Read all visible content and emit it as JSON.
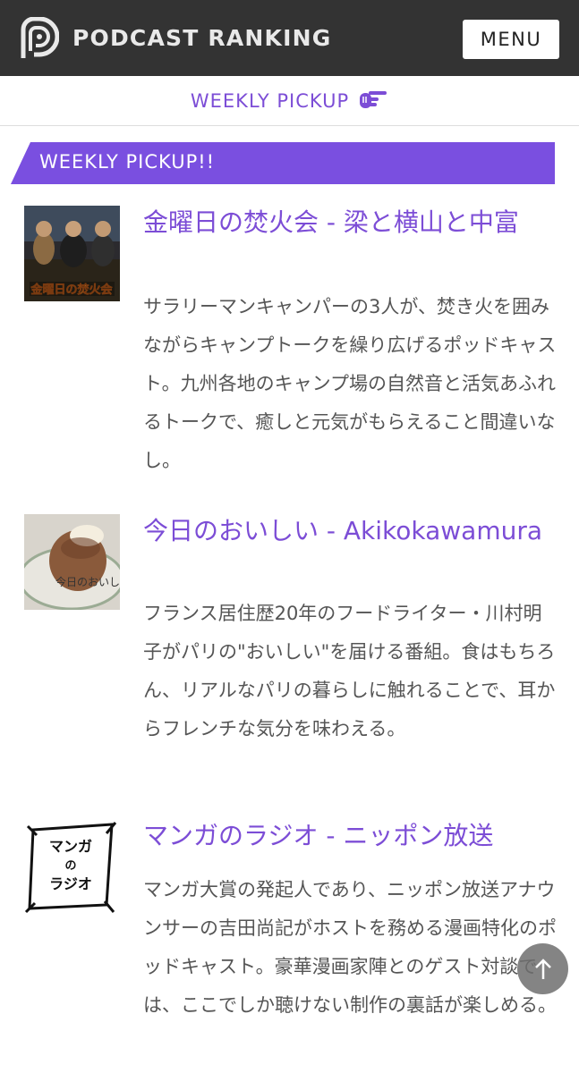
{
  "header": {
    "brand": "PODCAST RANKING",
    "menu_label": "MENU",
    "logo_icon": "podcast-p-logo-icon"
  },
  "nav": {
    "pickup_label": "WEEKLY PICKUP",
    "pickup_icon": "pointing-hand-icon"
  },
  "section": {
    "title": "WEEKLY PICKUP!!"
  },
  "items": [
    {
      "title": "金曜日の焚火会 - 梁と横山と中富",
      "description": "サラリーマンキャンパーの3人が、焚き火を囲みながらキャンプトークを繰り広げるポッドキャスト。九州各地のキャンプ場の自然音と活気あふれるトークで、癒しと元気がもらえること間違いなし。",
      "thumb_text": "金曜日の焚火会"
    },
    {
      "title": "今日のおいしい - Akikokawamura",
      "description": "フランス居住歴20年のフードライター・川村明子がパリの\"おいしい\"を届ける番組。食はもちろん、リアルなパリの暮らしに触れることで、耳からフレンチな気分を味わえる。",
      "thumb_text": "今日のおいしい"
    },
    {
      "title": "マンガのラジオ - ニッポン放送",
      "description": "マンガ大賞の発起人であり、ニッポン放送アナウンサーの吉田尚記がホストを務める漫画特化のポッドキャスト。豪華漫画家陣とのゲスト対談では、ここでしか聴けない制作の裏話が楽しめる。",
      "thumb_lines": [
        "マンガ",
        "の",
        "ラジオ"
      ]
    }
  ],
  "colors": {
    "accent": "#7c4dd6",
    "banner": "#7a4fe0",
    "topbar": "#333333",
    "body_text": "#555555"
  },
  "scroll_top_icon": "arrow-up-icon"
}
